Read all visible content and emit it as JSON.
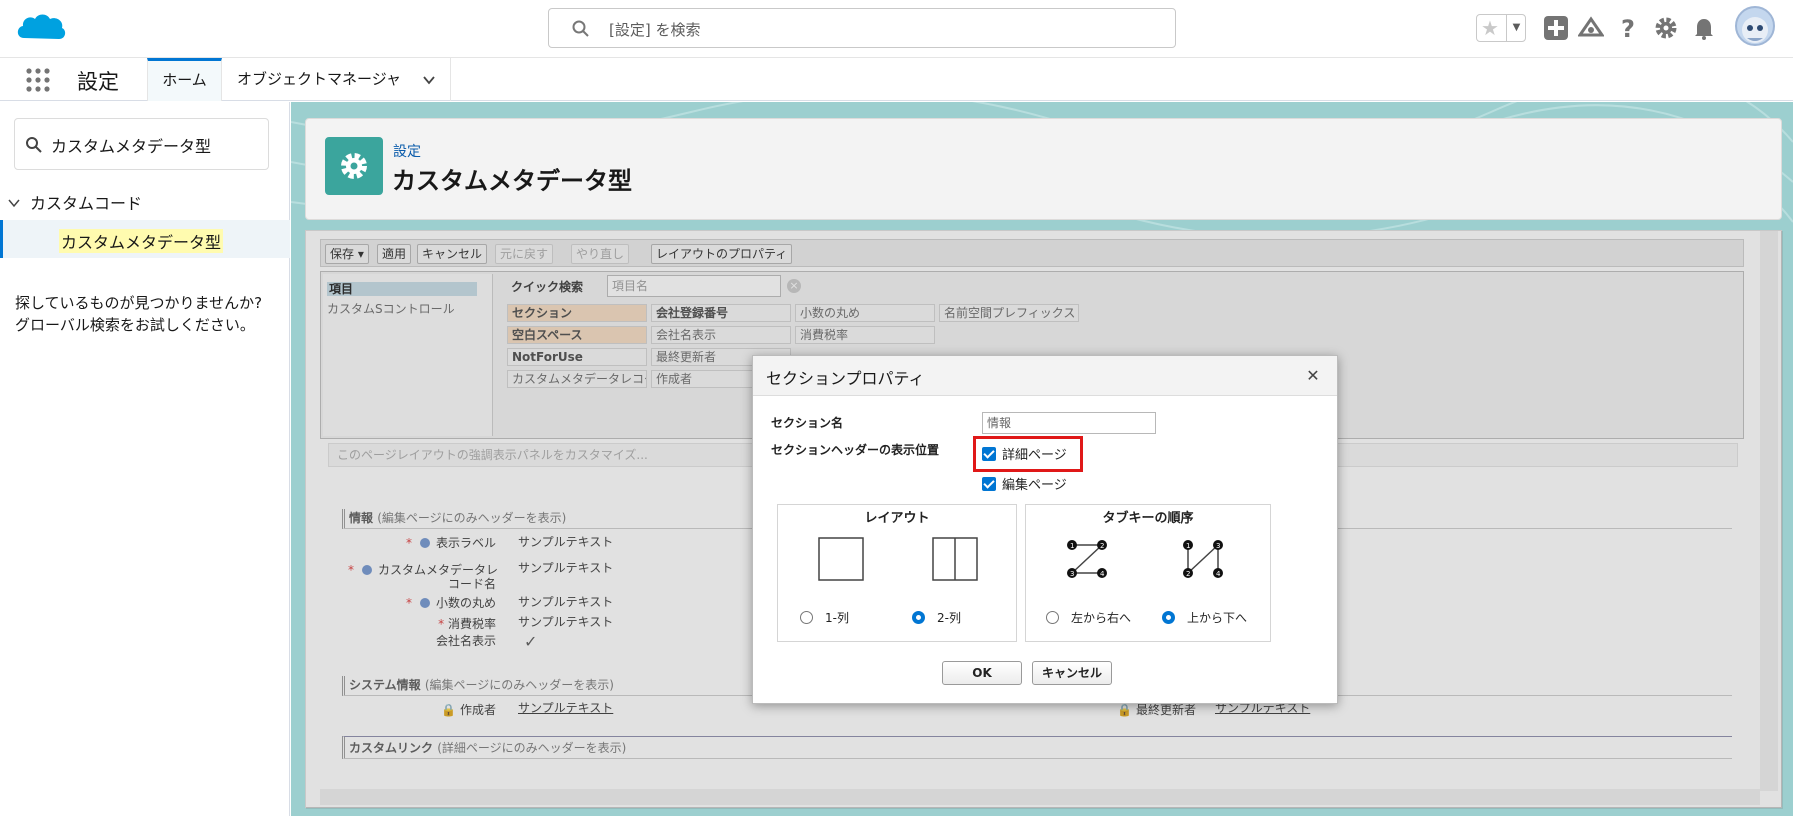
{
  "header": {
    "search_placeholder": "[設定] を検索",
    "icons": [
      "favorites-star-icon",
      "add-icon",
      "trailhead-icon",
      "help-icon",
      "gear-icon",
      "bell-icon",
      "avatar"
    ]
  },
  "nav": {
    "app_title": "設定",
    "tabs": [
      {
        "label": "ホーム",
        "active": true
      },
      {
        "label": "オブジェクトマネージャ",
        "has_dropdown": true
      }
    ]
  },
  "sidebar": {
    "quickfind_value": "カスタムメタデータ型",
    "tree": {
      "group": "カスタムコード",
      "item": "カスタムメタデータ型"
    },
    "help_line1": "探しているものが見つかりませんか?",
    "help_line2": "グローバル検索をお試しください。"
  },
  "page_header": {
    "breadcrumb": "設定",
    "title": "カスタムメタデータ型"
  },
  "layout_editor": {
    "toolbar": {
      "save": "保存 ▾",
      "apply": "適用",
      "cancel": "キャンセル",
      "undo": "元に戻す",
      "redo": "やり直し",
      "properties": "レイアウトのプロパティ"
    },
    "palette": {
      "categories": [
        "項目",
        "カスタムSコントロール"
      ],
      "quick_search_label": "クイック検索",
      "quick_search_placeholder": "項目名",
      "chips": [
        "セクション",
        "会社登録番号",
        "小数の丸め",
        "名前空間プレフィックス",
        "空白スペース",
        "会社名表示",
        "消費税率",
        "NotForUse",
        "最終更新者",
        "カスタムメタデータレコード名",
        "作成者"
      ]
    },
    "customize_text": "このページレイアウトの強調表示パネルをカスタマイズ...",
    "sections": [
      {
        "title": "情報",
        "note": "(編集ページにのみヘッダーを表示)"
      },
      {
        "title": "システム情報",
        "note": "(編集ページにのみヘッダーを表示)"
      },
      {
        "title": "カスタムリンク",
        "note": "(詳細ページにのみヘッダーを表示)"
      }
    ],
    "fields": {
      "label1": "表示ラベル",
      "label2a": "カスタムメタデータレ",
      "label2b": "コード名",
      "label3": "小数の丸め",
      "label4": "消費税率",
      "label5": "会社名表示",
      "sample": "サンプルテキスト",
      "creator": "作成者",
      "last_modified": "最終更新者",
      "checkmark": "✓"
    }
  },
  "modal": {
    "title": "セクションプロパティ",
    "section_name_label": "セクション名",
    "section_name_value": "情報",
    "header_position_label": "セクションヘッダーの表示位置",
    "detail_page": "詳細ページ",
    "edit_page": "編集ページ",
    "layout_title": "レイアウト",
    "layout_opt1": "1-列",
    "layout_opt2": "2-列",
    "layout_selected": "2-列",
    "tab_order_title": "タブキーの順序",
    "tab_opt1": "左から右へ",
    "tab_opt2": "上から下へ",
    "tab_selected": "上から下へ",
    "ok": "OK",
    "cancel": "キャンセル"
  },
  "colors": {
    "brand_blue": "#0176d3",
    "setup_teal": "#3ba59d",
    "background_teal": "#9ccfcf",
    "highlight_red": "#e01818"
  }
}
